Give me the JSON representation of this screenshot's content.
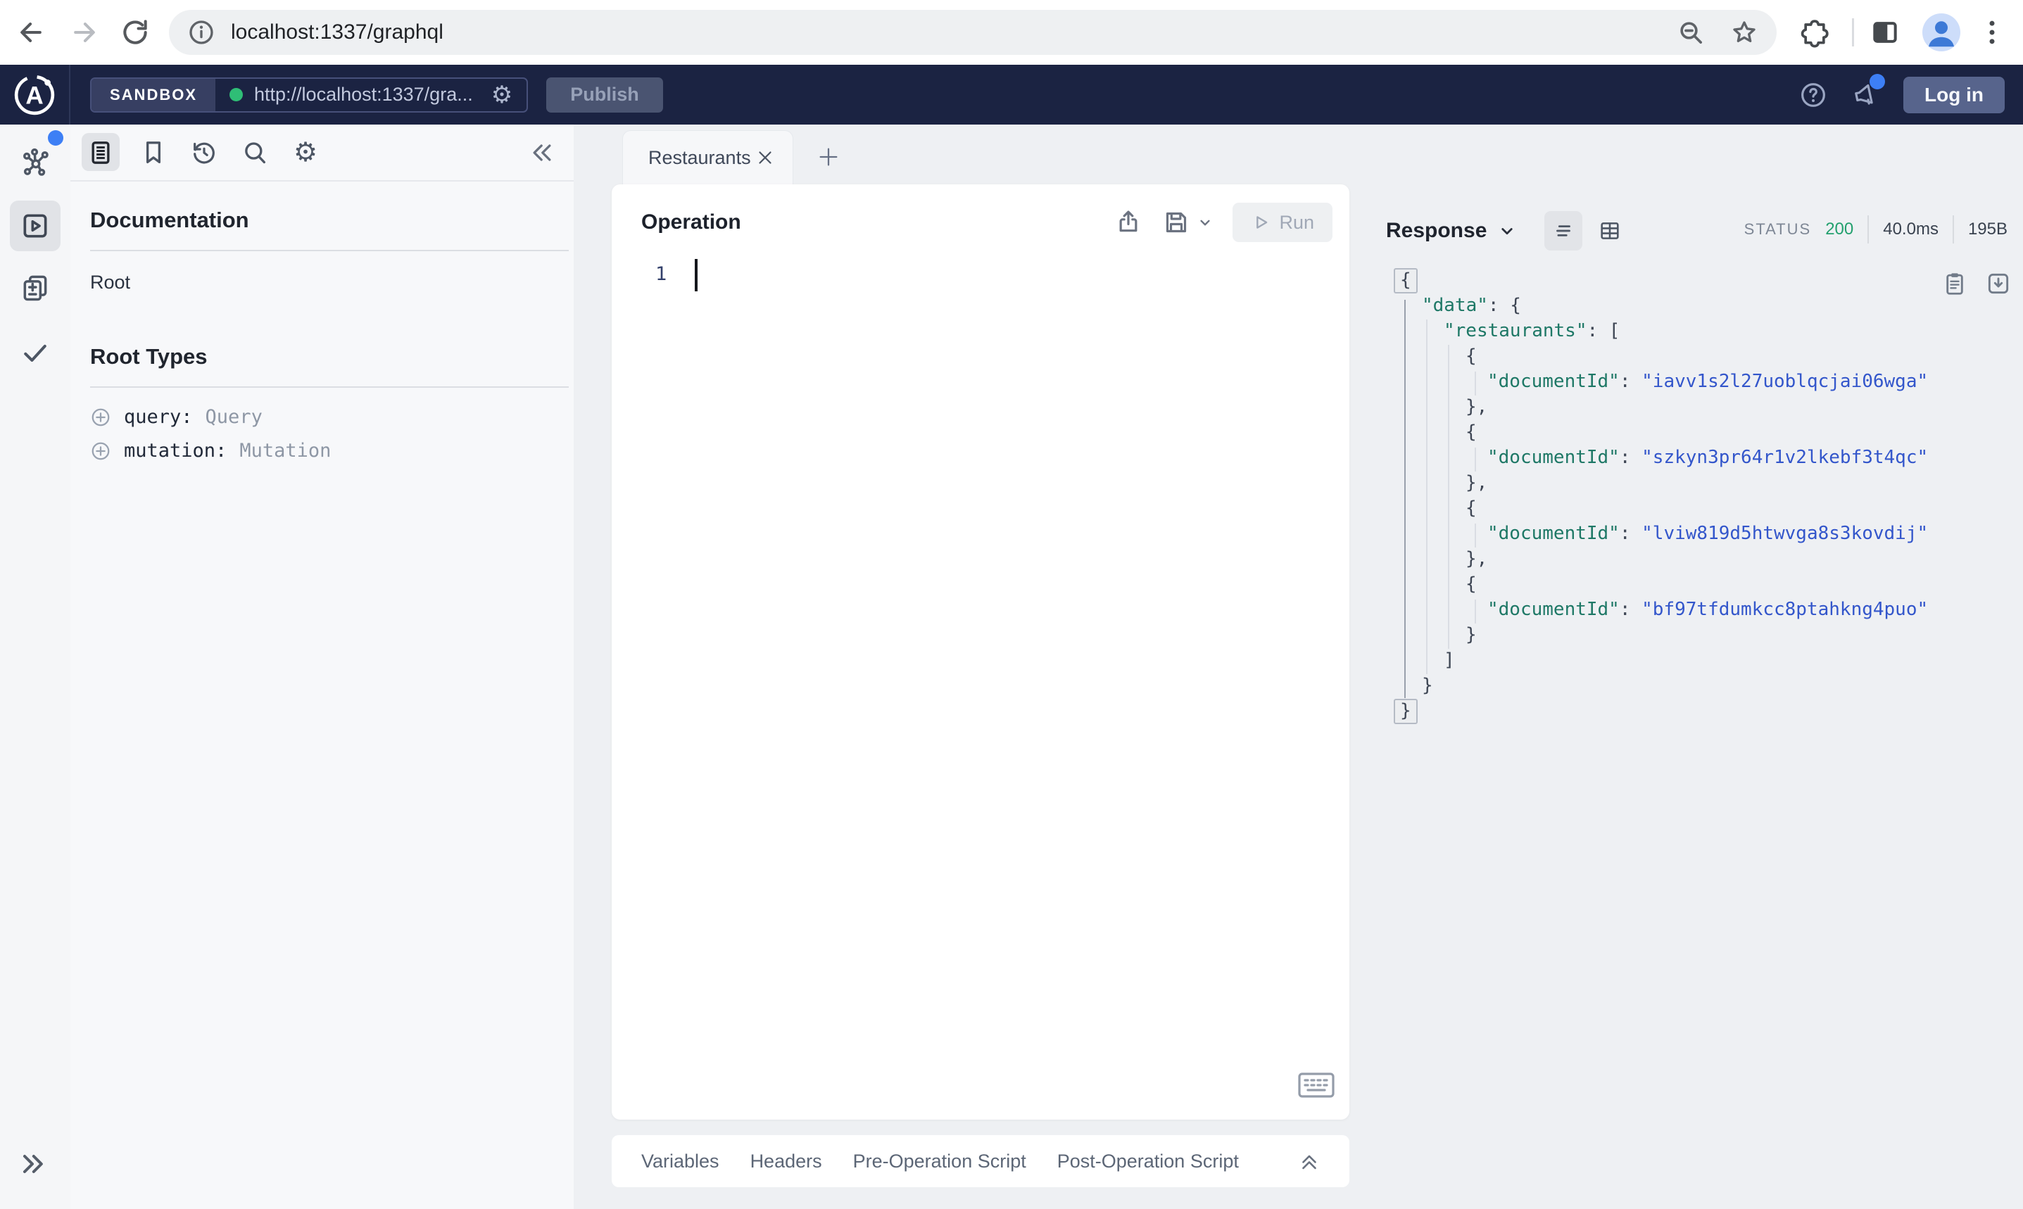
{
  "browser": {
    "url": "localhost:1337/graphql"
  },
  "appbar": {
    "brand_letter": "A",
    "env_label": "SANDBOX",
    "endpoint": "http://localhost:1337/gra...",
    "publish_label": "Publish",
    "login_label": "Log in"
  },
  "docs": {
    "title": "Documentation",
    "root_item": "Root",
    "section_title": "Root Types",
    "root_types": [
      {
        "field": "query:",
        "type": "Query"
      },
      {
        "field": "mutation:",
        "type": "Mutation"
      }
    ]
  },
  "tabs": {
    "active_tab": "Restaurants"
  },
  "operation": {
    "title": "Operation",
    "run_label": "Run",
    "line_number": "1",
    "secondary_tabs": [
      "Variables",
      "Headers",
      "Pre-Operation Script",
      "Post-Operation Script"
    ]
  },
  "response": {
    "title": "Response",
    "status_label": "STATUS",
    "status_code": "200",
    "time": "40.0ms",
    "size": "195B",
    "document_ids": [
      "iavv1s2l27uoblqcjai06wga",
      "szkyn3pr64r1v2lkebf3t4qc",
      "lviw819d5htwvga8s3kovdij",
      "bf97tfdumkcc8ptahkng4puo"
    ],
    "json_lines": [
      {
        "indent": 0,
        "fold": true,
        "segs": [
          {
            "c": "p",
            "t": "{"
          }
        ]
      },
      {
        "indent": 1,
        "segs": [
          {
            "c": "k",
            "t": "\"data\""
          },
          {
            "c": "p",
            "t": ": {"
          }
        ]
      },
      {
        "indent": 2,
        "segs": [
          {
            "c": "k",
            "t": "\"restaurants\""
          },
          {
            "c": "p",
            "t": ": ["
          }
        ]
      },
      {
        "indent": 3,
        "segs": [
          {
            "c": "p",
            "t": "{"
          }
        ]
      },
      {
        "indent": 4,
        "segs": [
          {
            "c": "k",
            "t": "\"documentId\""
          },
          {
            "c": "p",
            "t": ": "
          },
          {
            "c": "s",
            "t": "\"iavv1s2l27uoblqcjai06wga\""
          }
        ]
      },
      {
        "indent": 3,
        "segs": [
          {
            "c": "p",
            "t": "},"
          }
        ]
      },
      {
        "indent": 3,
        "segs": [
          {
            "c": "p",
            "t": "{"
          }
        ]
      },
      {
        "indent": 4,
        "segs": [
          {
            "c": "k",
            "t": "\"documentId\""
          },
          {
            "c": "p",
            "t": ": "
          },
          {
            "c": "s",
            "t": "\"szkyn3pr64r1v2lkebf3t4qc\""
          }
        ]
      },
      {
        "indent": 3,
        "segs": [
          {
            "c": "p",
            "t": "},"
          }
        ]
      },
      {
        "indent": 3,
        "segs": [
          {
            "c": "p",
            "t": "{"
          }
        ]
      },
      {
        "indent": 4,
        "segs": [
          {
            "c": "k",
            "t": "\"documentId\""
          },
          {
            "c": "p",
            "t": ": "
          },
          {
            "c": "s",
            "t": "\"lviw819d5htwvga8s3kovdij\""
          }
        ]
      },
      {
        "indent": 3,
        "segs": [
          {
            "c": "p",
            "t": "},"
          }
        ]
      },
      {
        "indent": 3,
        "segs": [
          {
            "c": "p",
            "t": "{"
          }
        ]
      },
      {
        "indent": 4,
        "segs": [
          {
            "c": "k",
            "t": "\"documentId\""
          },
          {
            "c": "p",
            "t": ": "
          },
          {
            "c": "s",
            "t": "\"bf97tfdumkcc8ptahkng4puo\""
          }
        ]
      },
      {
        "indent": 3,
        "segs": [
          {
            "c": "p",
            "t": "}"
          }
        ]
      },
      {
        "indent": 2,
        "segs": [
          {
            "c": "p",
            "t": "]"
          }
        ]
      },
      {
        "indent": 1,
        "segs": [
          {
            "c": "p",
            "t": "}"
          }
        ]
      },
      {
        "indent": 0,
        "fold": true,
        "segs": [
          {
            "c": "p",
            "t": "}"
          }
        ]
      }
    ]
  },
  "colors": {
    "header_bg": "#1b2342",
    "endpoint_online_dot": "#2fbe76",
    "notification_badge": "#3d7ff5",
    "status_ok": "#23a06e",
    "json_key": "#1e7866",
    "json_string": "#3356cb"
  }
}
